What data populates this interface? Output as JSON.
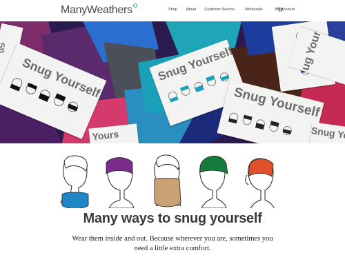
{
  "header": {
    "logo": "ManyWeathers",
    "nav": [
      "Shop",
      "About",
      "Customer Service",
      "Wholesale",
      "My Account"
    ],
    "cart_icon": "cart-icon"
  },
  "hero": {
    "card_text": "Snug Yourself",
    "card_text_partial": "Snug Yourse",
    "card_text_partial2": "Snug Yours",
    "card_text_edge": "Yours",
    "card_text_edge2": "ug Yourse",
    "card_text_edge3": "Sn"
  },
  "main": {
    "heading": "Many ways to snug yourself",
    "description": "Wear them inside and out. Because wherever you are, sometimes you need a little extra comfort."
  },
  "colors": {
    "blue": "#1f86c8",
    "purple": "#7b2d8c",
    "tan": "#c9a274",
    "green": "#167a3c",
    "orange": "#e0502a"
  }
}
